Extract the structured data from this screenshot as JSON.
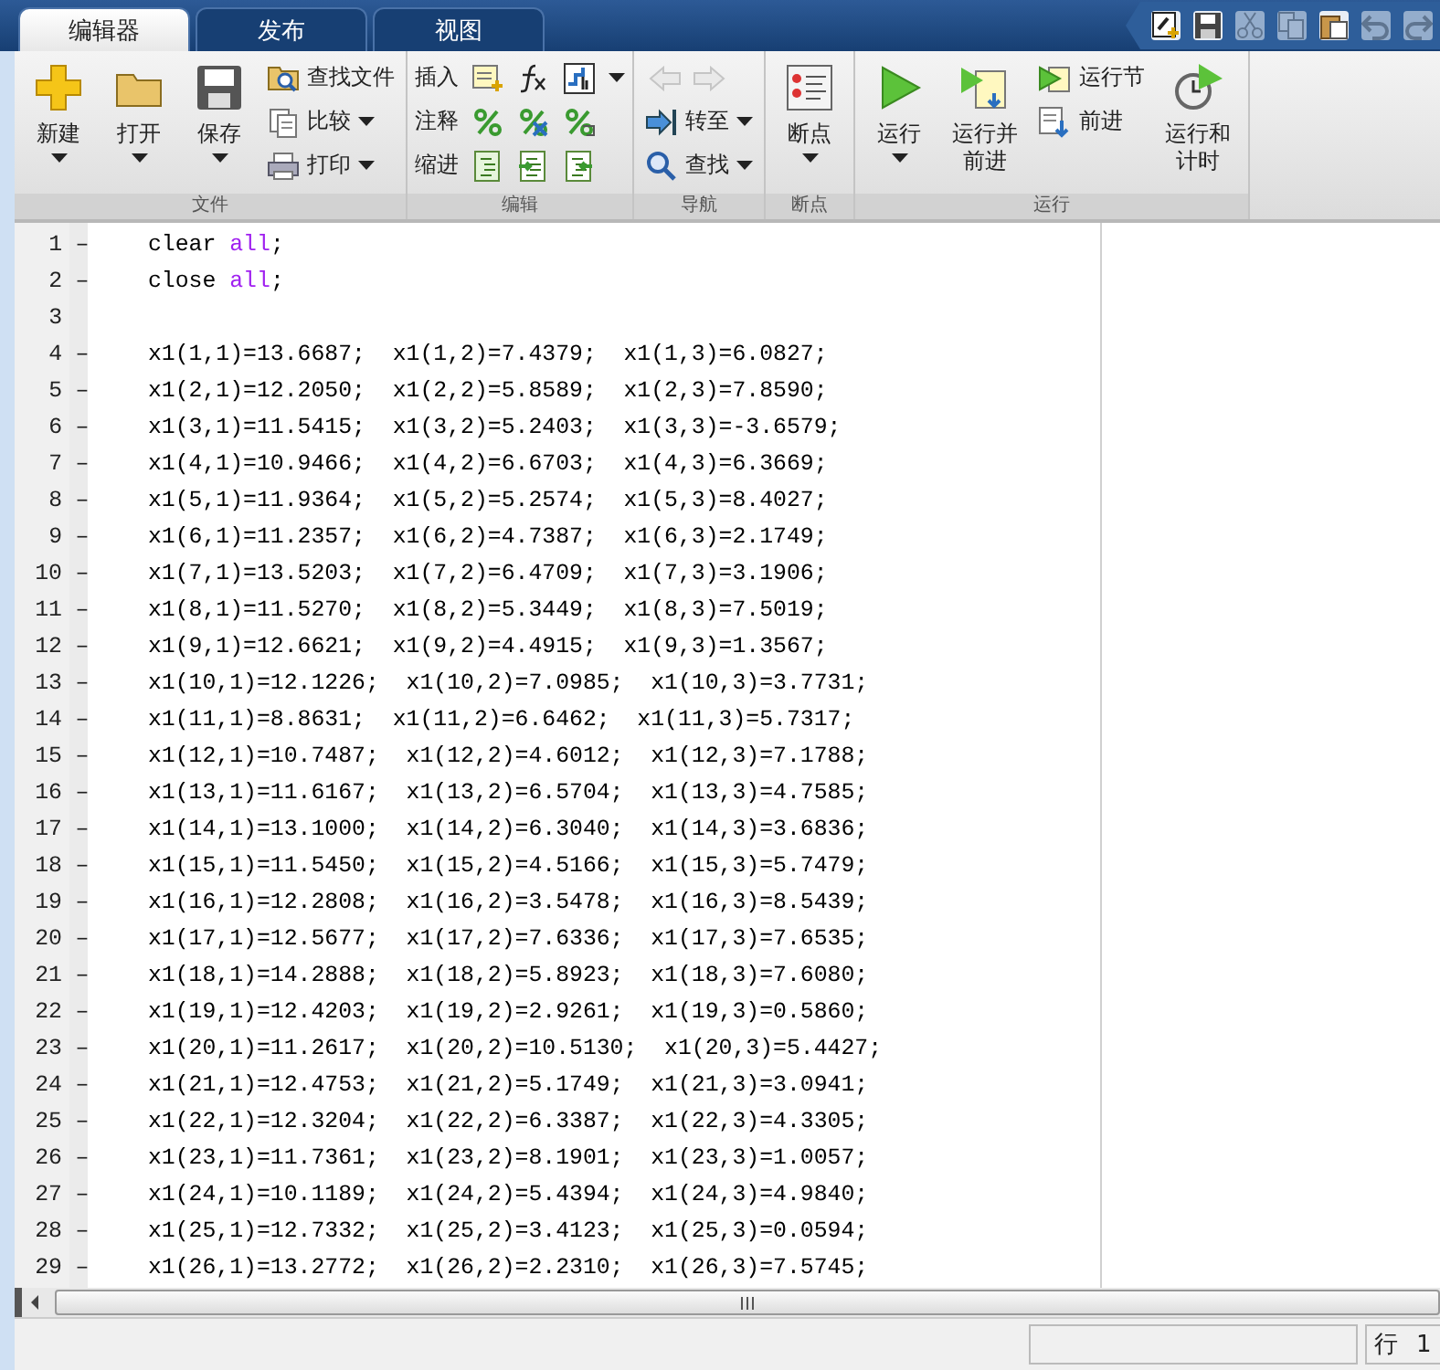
{
  "tabs": [
    {
      "label": "编辑器",
      "selected": true
    },
    {
      "label": "发布",
      "selected": false
    },
    {
      "label": "视图",
      "selected": false
    }
  ],
  "quick_access": [
    {
      "disabled": false
    },
    {
      "disabled": false
    },
    {
      "disabled": true
    },
    {
      "disabled": true
    },
    {
      "disabled": false
    },
    {
      "disabled": true
    },
    {
      "disabled": true
    }
  ],
  "ribbon": {
    "groups": [
      {
        "title": "文件",
        "large": [
          {
            "label": "新建",
            "dropdown": true
          },
          {
            "label": "打开",
            "dropdown": true
          },
          {
            "label": "保存",
            "dropdown": true
          }
        ],
        "small": [
          {
            "label": "查找文件",
            "dropdown": false
          },
          {
            "label": "比较",
            "dropdown": true
          },
          {
            "label": "打印",
            "dropdown": true
          }
        ]
      },
      {
        "title": "编辑",
        "rows": [
          {
            "label": "插入",
            "dropdown": true
          },
          {
            "label": "注释",
            "dropdown": false
          },
          {
            "label": "缩进",
            "dropdown": false
          }
        ]
      },
      {
        "title": "导航",
        "arrows_disabled": true,
        "small": [
          {
            "label": "转至",
            "dropdown": true
          },
          {
            "label": "查找",
            "dropdown": true
          }
        ]
      },
      {
        "title": "断点",
        "large": [
          {
            "label": "断点",
            "dropdown": true
          }
        ]
      },
      {
        "title": "运行",
        "large": [
          {
            "label": "运行",
            "dropdown": true
          },
          {
            "label": "运行并前进",
            "dropdown": false
          }
        ],
        "small": [
          {
            "label": "运行节",
            "dropdown": false
          },
          {
            "label": "前进",
            "dropdown": false
          }
        ],
        "large_after": [
          {
            "label": "运行和计时",
            "dropdown": false
          }
        ]
      }
    ]
  },
  "editor": {
    "lines": [
      {
        "number": "1",
        "marker": "–",
        "segments": [
          {
            "text": "clear ",
            "kind": "code"
          },
          {
            "text": "all",
            "kind": "keyword"
          },
          {
            "text": ";",
            "kind": "code"
          }
        ]
      },
      {
        "number": "2",
        "marker": "–",
        "segments": [
          {
            "text": "close ",
            "kind": "code"
          },
          {
            "text": "all",
            "kind": "keyword"
          },
          {
            "text": ";",
            "kind": "code"
          }
        ]
      },
      {
        "number": "3"
      },
      {
        "number": "4",
        "marker": "–",
        "segments": [
          {
            "text": "x1(1,1)=13.6687;  x1(1,2)=7.4379;  x1(1,3)=6.0827;",
            "kind": "code"
          }
        ]
      },
      {
        "number": "5",
        "marker": "–",
        "segments": [
          {
            "text": "x1(2,1)=12.2050;  x1(2,2)=5.8589;  x1(2,3)=7.8590;",
            "kind": "code"
          }
        ]
      },
      {
        "number": "6",
        "marker": "–",
        "segments": [
          {
            "text": "x1(3,1)=11.5415;  x1(3,2)=5.2403;  x1(3,3)=-3.6579;",
            "kind": "code"
          }
        ]
      },
      {
        "number": "7",
        "marker": "–",
        "segments": [
          {
            "text": "x1(4,1)=10.9466;  x1(4,2)=6.6703;  x1(4,3)=6.3669;",
            "kind": "code"
          }
        ]
      },
      {
        "number": "8",
        "marker": "–",
        "segments": [
          {
            "text": "x1(5,1)=11.9364;  x1(5,2)=5.2574;  x1(5,3)=8.4027;",
            "kind": "code"
          }
        ]
      },
      {
        "number": "9",
        "marker": "–",
        "segments": [
          {
            "text": "x1(6,1)=11.2357;  x1(6,2)=4.7387;  x1(6,3)=2.1749;",
            "kind": "code"
          }
        ]
      },
      {
        "number": "10",
        "marker": "–",
        "segments": [
          {
            "text": "x1(7,1)=13.5203;  x1(7,2)=6.4709;  x1(7,3)=3.1906;",
            "kind": "code"
          }
        ]
      },
      {
        "number": "11",
        "marker": "–",
        "segments": [
          {
            "text": "x1(8,1)=11.5270;  x1(8,2)=5.3449;  x1(8,3)=7.5019;",
            "kind": "code"
          }
        ]
      },
      {
        "number": "12",
        "marker": "–",
        "segments": [
          {
            "text": "x1(9,1)=12.6621;  x1(9,2)=4.4915;  x1(9,3)=1.3567;",
            "kind": "code"
          }
        ]
      },
      {
        "number": "13",
        "marker": "–",
        "segments": [
          {
            "text": "x1(10,1)=12.1226;  x1(10,2)=7.0985;  x1(10,3)=3.7731;",
            "kind": "code"
          }
        ]
      },
      {
        "number": "14",
        "marker": "–",
        "segments": [
          {
            "text": "x1(11,1)=8.8631;  x1(11,2)=6.6462;  x1(11,3)=5.7317;",
            "kind": "code"
          }
        ]
      },
      {
        "number": "15",
        "marker": "–",
        "segments": [
          {
            "text": "x1(12,1)=10.7487;  x1(12,2)=4.6012;  x1(12,3)=7.1788;",
            "kind": "code"
          }
        ]
      },
      {
        "number": "16",
        "marker": "–",
        "segments": [
          {
            "text": "x1(13,1)=11.6167;  x1(13,2)=6.5704;  x1(13,3)=4.7585;",
            "kind": "code"
          }
        ]
      },
      {
        "number": "17",
        "marker": "–",
        "segments": [
          {
            "text": "x1(14,1)=13.1000;  x1(14,2)=6.3040;  x1(14,3)=3.6836;",
            "kind": "code"
          }
        ]
      },
      {
        "number": "18",
        "marker": "–",
        "segments": [
          {
            "text": "x1(15,1)=11.5450;  x1(15,2)=4.5166;  x1(15,3)=5.7479;",
            "kind": "code"
          }
        ]
      },
      {
        "number": "19",
        "marker": "–",
        "segments": [
          {
            "text": "x1(16,1)=12.2808;  x1(16,2)=3.5478;  x1(16,3)=8.5439;",
            "kind": "code"
          }
        ]
      },
      {
        "number": "20",
        "marker": "–",
        "segments": [
          {
            "text": "x1(17,1)=12.5677;  x1(17,2)=7.6336;  x1(17,3)=7.6535;",
            "kind": "code"
          }
        ]
      },
      {
        "number": "21",
        "marker": "–",
        "segments": [
          {
            "text": "x1(18,1)=14.2888;  x1(18,2)=5.8923;  x1(18,3)=7.6080;",
            "kind": "code"
          }
        ]
      },
      {
        "number": "22",
        "marker": "–",
        "segments": [
          {
            "text": "x1(19,1)=12.4203;  x1(19,2)=2.9261;  x1(19,3)=0.5860;",
            "kind": "code"
          }
        ]
      },
      {
        "number": "23",
        "marker": "–",
        "segments": [
          {
            "text": "x1(20,1)=11.2617;  x1(20,2)=10.5130;  x1(20,3)=5.4427;",
            "kind": "code"
          }
        ]
      },
      {
        "number": "24",
        "marker": "–",
        "segments": [
          {
            "text": "x1(21,1)=12.4753;  x1(21,2)=5.1749;  x1(21,3)=3.0941;",
            "kind": "code"
          }
        ]
      },
      {
        "number": "25",
        "marker": "–",
        "segments": [
          {
            "text": "x1(22,1)=12.3204;  x1(22,2)=6.3387;  x1(22,3)=4.3305;",
            "kind": "code"
          }
        ]
      },
      {
        "number": "26",
        "marker": "–",
        "segments": [
          {
            "text": "x1(23,1)=11.7361;  x1(23,2)=8.1901;  x1(23,3)=1.0057;",
            "kind": "code"
          }
        ]
      },
      {
        "number": "27",
        "marker": "–",
        "segments": [
          {
            "text": "x1(24,1)=10.1189;  x1(24,2)=5.4394;  x1(24,3)=4.9840;",
            "kind": "code"
          }
        ]
      },
      {
        "number": "28",
        "marker": "–",
        "segments": [
          {
            "text": "x1(25,1)=12.7332;  x1(25,2)=3.4123;  x1(25,3)=0.0594;",
            "kind": "code"
          }
        ]
      },
      {
        "number": "29",
        "marker": "–",
        "segments": [
          {
            "text": "x1(26,1)=13.2772;  x1(26,2)=2.2310;  x1(26,3)=7.5745;",
            "kind": "code"
          }
        ]
      }
    ]
  },
  "status_bar": {
    "row_label": "行",
    "row_value": "1"
  }
}
